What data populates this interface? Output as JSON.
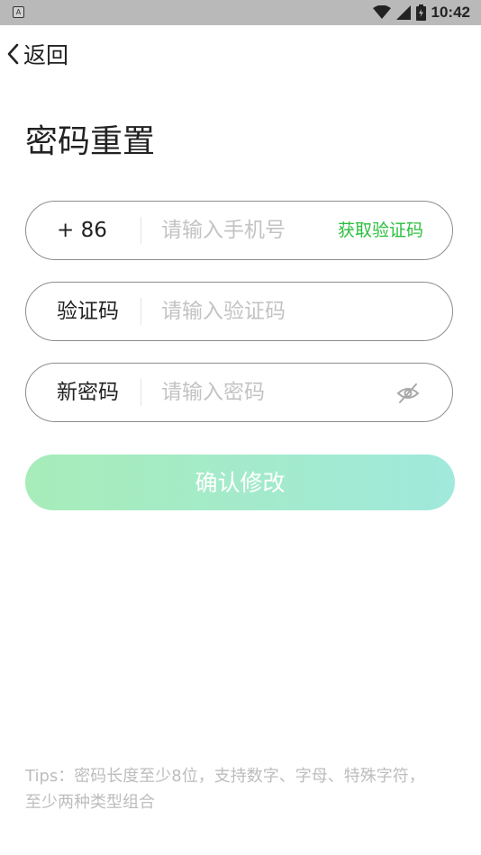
{
  "status_bar": {
    "notification_icon": "A",
    "icons": [
      "wifi-icon",
      "signal-icon",
      "battery-icon"
    ],
    "time": "10:42"
  },
  "nav": {
    "back_label": "返回"
  },
  "page": {
    "title": "密码重置"
  },
  "form": {
    "phone": {
      "prefix": "+ 86",
      "placeholder": "请输入手机号",
      "value": "",
      "get_code_label": "获取验证码"
    },
    "code": {
      "label": "验证码",
      "placeholder": "请输入验证码",
      "value": ""
    },
    "password": {
      "label": "新密码",
      "placeholder": "请输入密码",
      "value": "",
      "toggle_icon": "eye-hidden-icon"
    },
    "submit_label": "确认修改"
  },
  "tips": "Tips：密码长度至少8位，支持数字、字母、特殊字符，至少两种类型组合",
  "colors": {
    "accent_green": "#2bbf3d",
    "button_gradient_start": "#a7ecb9",
    "button_gradient_end": "#a0e9dc",
    "status_bar": "#b9b9b9"
  }
}
